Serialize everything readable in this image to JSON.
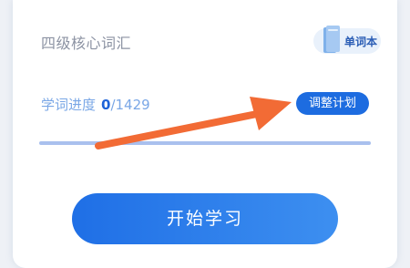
{
  "book": {
    "title": "四级核心词汇",
    "vocab_label": "单词本",
    "vocab_icon": "book-icon"
  },
  "progress": {
    "label": "学词进度",
    "current": "0",
    "total_text": "/1429",
    "fraction": 0,
    "adjust_label": "调整计划"
  },
  "actions": {
    "start_label": "开始学习"
  },
  "annotation": {
    "arrow_icon": "arrow-annotation",
    "arrow_color": "#f26b35"
  },
  "colors": {
    "accent": "#1d6ce0",
    "track": "#a9c0ee"
  }
}
